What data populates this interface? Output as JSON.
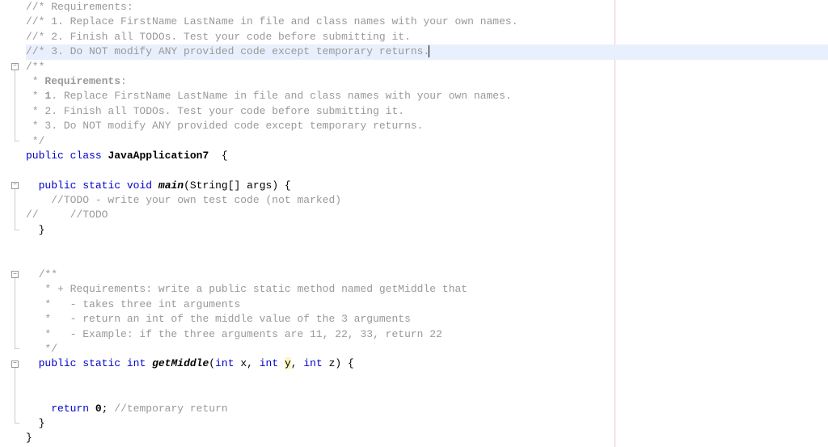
{
  "lines": [
    {
      "indent": 0,
      "segments": [
        {
          "cls": "comment",
          "text": "//* Requirements:"
        }
      ]
    },
    {
      "indent": 0,
      "segments": [
        {
          "cls": "comment",
          "text": "//* 1. Replace FirstName LastName in file and class names with your own names."
        }
      ]
    },
    {
      "indent": 0,
      "segments": [
        {
          "cls": "comment",
          "text": "//* 2. Finish all TODOs. Test your code before submitting it."
        }
      ]
    },
    {
      "indent": 0,
      "highlighted": true,
      "cursor": true,
      "segments": [
        {
          "cls": "comment",
          "text": "//* 3. Do NOT modify ANY provided code except temporary returns."
        }
      ]
    },
    {
      "indent": 0,
      "fold": "open",
      "segments": [
        {
          "cls": "comment",
          "text": "/**"
        }
      ]
    },
    {
      "indent": 0,
      "segments": [
        {
          "cls": "comment",
          "text": " * "
        },
        {
          "cls": "doc-bold",
          "text": "Requirements"
        },
        {
          "cls": "comment",
          "text": ":"
        }
      ]
    },
    {
      "indent": 0,
      "segments": [
        {
          "cls": "comment",
          "text": " * "
        },
        {
          "cls": "doc-bold",
          "text": "1"
        },
        {
          "cls": "comment",
          "text": ". Replace FirstName LastName in file and class names with your own names."
        }
      ]
    },
    {
      "indent": 0,
      "segments": [
        {
          "cls": "comment",
          "text": " * 2. Finish all TODOs. Test your code before submitting it."
        }
      ]
    },
    {
      "indent": 0,
      "segments": [
        {
          "cls": "comment",
          "text": " * 3. Do NOT modify ANY provided code except temporary returns."
        }
      ]
    },
    {
      "indent": 0,
      "foldEnd": true,
      "segments": [
        {
          "cls": "comment",
          "text": " */"
        }
      ]
    },
    {
      "indent": 0,
      "segments": [
        {
          "cls": "keyword",
          "text": "public"
        },
        {
          "cls": "plain",
          "text": " "
        },
        {
          "cls": "keyword",
          "text": "class"
        },
        {
          "cls": "plain",
          "text": " "
        },
        {
          "cls": "classname",
          "text": "JavaApplication7"
        },
        {
          "cls": "plain",
          "text": "  {"
        }
      ]
    },
    {
      "indent": 0,
      "segments": [
        {
          "cls": "plain",
          "text": ""
        }
      ]
    },
    {
      "indent": 2,
      "fold": "open",
      "segments": [
        {
          "cls": "keyword",
          "text": "public"
        },
        {
          "cls": "plain",
          "text": " "
        },
        {
          "cls": "keyword",
          "text": "static"
        },
        {
          "cls": "plain",
          "text": " "
        },
        {
          "cls": "keyword",
          "text": "void"
        },
        {
          "cls": "plain",
          "text": " "
        },
        {
          "cls": "methodname",
          "text": "main"
        },
        {
          "cls": "plain",
          "text": "(String[] args) {"
        }
      ]
    },
    {
      "indent": 4,
      "segments": [
        {
          "cls": "comment",
          "text": "//TODO - write your own test code (not marked)"
        }
      ]
    },
    {
      "indent": 0,
      "segments": [
        {
          "cls": "comment",
          "text": "//     //TODO"
        }
      ]
    },
    {
      "indent": 2,
      "foldEnd": true,
      "segments": [
        {
          "cls": "plain",
          "text": "}"
        }
      ]
    },
    {
      "indent": 0,
      "segments": [
        {
          "cls": "plain",
          "text": ""
        }
      ]
    },
    {
      "indent": 0,
      "segments": [
        {
          "cls": "plain",
          "text": ""
        }
      ]
    },
    {
      "indent": 2,
      "fold": "open",
      "segments": [
        {
          "cls": "comment",
          "text": "/**"
        }
      ]
    },
    {
      "indent": 2,
      "segments": [
        {
          "cls": "comment",
          "text": " * + Requirements: write a public static method named getMiddle that"
        }
      ]
    },
    {
      "indent": 2,
      "segments": [
        {
          "cls": "comment",
          "text": " *   - takes three int arguments"
        }
      ]
    },
    {
      "indent": 2,
      "segments": [
        {
          "cls": "comment",
          "text": " *   - return an int of the middle value of the 3 arguments"
        }
      ]
    },
    {
      "indent": 2,
      "segments": [
        {
          "cls": "comment",
          "text": " *   - Example: if the three arguments are 11, 22, 33, return 22"
        }
      ]
    },
    {
      "indent": 2,
      "foldEnd": true,
      "segments": [
        {
          "cls": "comment",
          "text": " */"
        }
      ]
    },
    {
      "indent": 2,
      "fold": "open",
      "segments": [
        {
          "cls": "keyword",
          "text": "public"
        },
        {
          "cls": "plain",
          "text": " "
        },
        {
          "cls": "keyword",
          "text": "static"
        },
        {
          "cls": "plain",
          "text": " "
        },
        {
          "cls": "keyword",
          "text": "int"
        },
        {
          "cls": "plain",
          "text": " "
        },
        {
          "cls": "methodname",
          "text": "getMiddle"
        },
        {
          "cls": "plain",
          "text": "("
        },
        {
          "cls": "keyword",
          "text": "int"
        },
        {
          "cls": "plain",
          "text": " x, "
        },
        {
          "cls": "keyword",
          "text": "int"
        },
        {
          "cls": "plain",
          "text": " "
        },
        {
          "cls": "param-highlight",
          "text": "y"
        },
        {
          "cls": "plain",
          "text": ", "
        },
        {
          "cls": "keyword",
          "text": "int"
        },
        {
          "cls": "plain",
          "text": " z) {"
        }
      ]
    },
    {
      "indent": 0,
      "segments": [
        {
          "cls": "plain",
          "text": ""
        }
      ]
    },
    {
      "indent": 0,
      "segments": [
        {
          "cls": "plain",
          "text": ""
        }
      ]
    },
    {
      "indent": 4,
      "segments": [
        {
          "cls": "keyword",
          "text": "return"
        },
        {
          "cls": "plain",
          "text": " "
        },
        {
          "cls": "number",
          "text": "0"
        },
        {
          "cls": "plain",
          "text": "; "
        },
        {
          "cls": "comment",
          "text": "//temporary return"
        }
      ]
    },
    {
      "indent": 2,
      "foldEnd": true,
      "segments": [
        {
          "cls": "plain",
          "text": "}"
        }
      ]
    },
    {
      "indent": 0,
      "segments": [
        {
          "cls": "plain",
          "text": "}"
        }
      ]
    }
  ]
}
